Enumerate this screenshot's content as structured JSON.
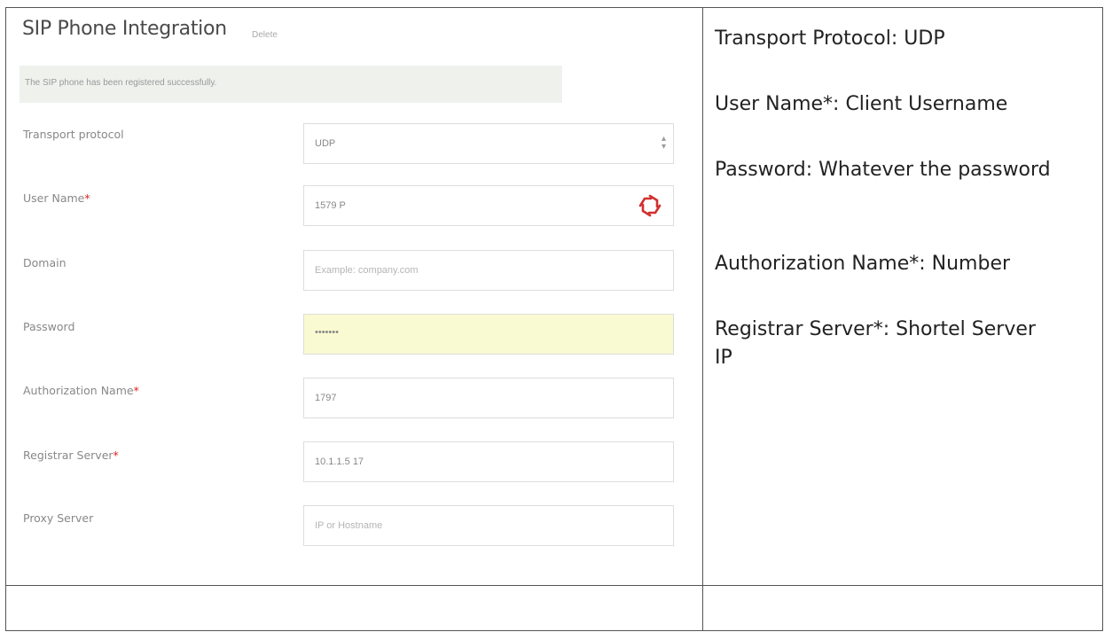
{
  "panel": {
    "title": "SIP Phone Integration",
    "delete_label": "Delete",
    "alert": "The SIP phone has been registered successfully."
  },
  "fields": {
    "transport_label": "Transport protocol",
    "transport_value": "UDP",
    "username_label": "User Name",
    "username_value": "1579 P",
    "domain_label": "Domain",
    "domain_placeholder": "Example: company.com",
    "password_label": "Password",
    "password_value": "•••••••",
    "auth_label": "Authorization Name",
    "auth_value": "1797",
    "registrar_label": "Registrar Server",
    "registrar_value": "10.1.1.5 17",
    "proxy_label": "Proxy Server",
    "proxy_placeholder": "IP or Hostname",
    "required_mark": "*"
  },
  "notes": {
    "transport": "Transport Protocol: UDP",
    "username": "User Name*: Client Username",
    "password": "Password: Whatever the password",
    "authorization": "Authorization Name*: Number",
    "registrar": "Registrar Server*: Shortel Server IP"
  },
  "colors": {
    "required": "#dd2222",
    "password_bg": "#fafad2",
    "icon_red": "#d32f2f"
  }
}
